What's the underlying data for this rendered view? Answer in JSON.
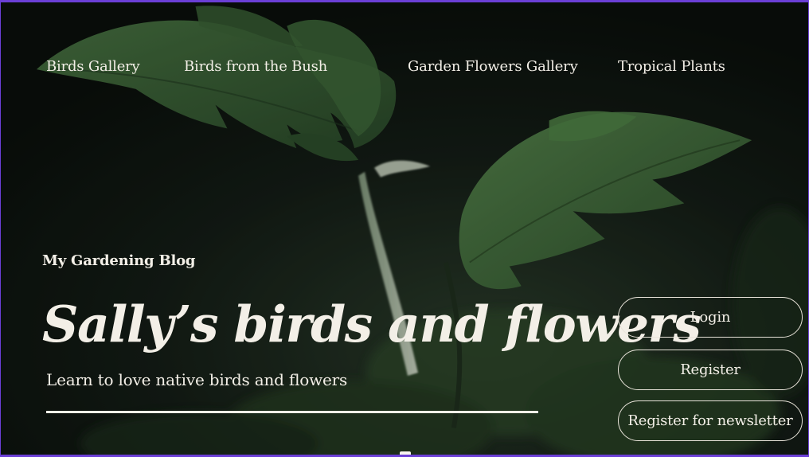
{
  "nav": {
    "items": [
      {
        "label": "Birds Gallery"
      },
      {
        "label": "Birds from the Bush"
      },
      {
        "label": "Garden Flowers Gallery"
      },
      {
        "label": "Tropical Plants"
      }
    ]
  },
  "hero": {
    "eyebrow": "My Gardening Blog",
    "title": "Sally’s birds and flowers",
    "subtitle": "Learn to love native birds and flowers"
  },
  "actions": {
    "login_label": "Login",
    "register_label": "Register",
    "newsletter_label": "Register for newsletter"
  },
  "colors": {
    "text": "#f3efe7",
    "frame_border": "#6b3fd6",
    "leaf_green": "#3f6a3c",
    "background_dark": "#0d130f"
  }
}
